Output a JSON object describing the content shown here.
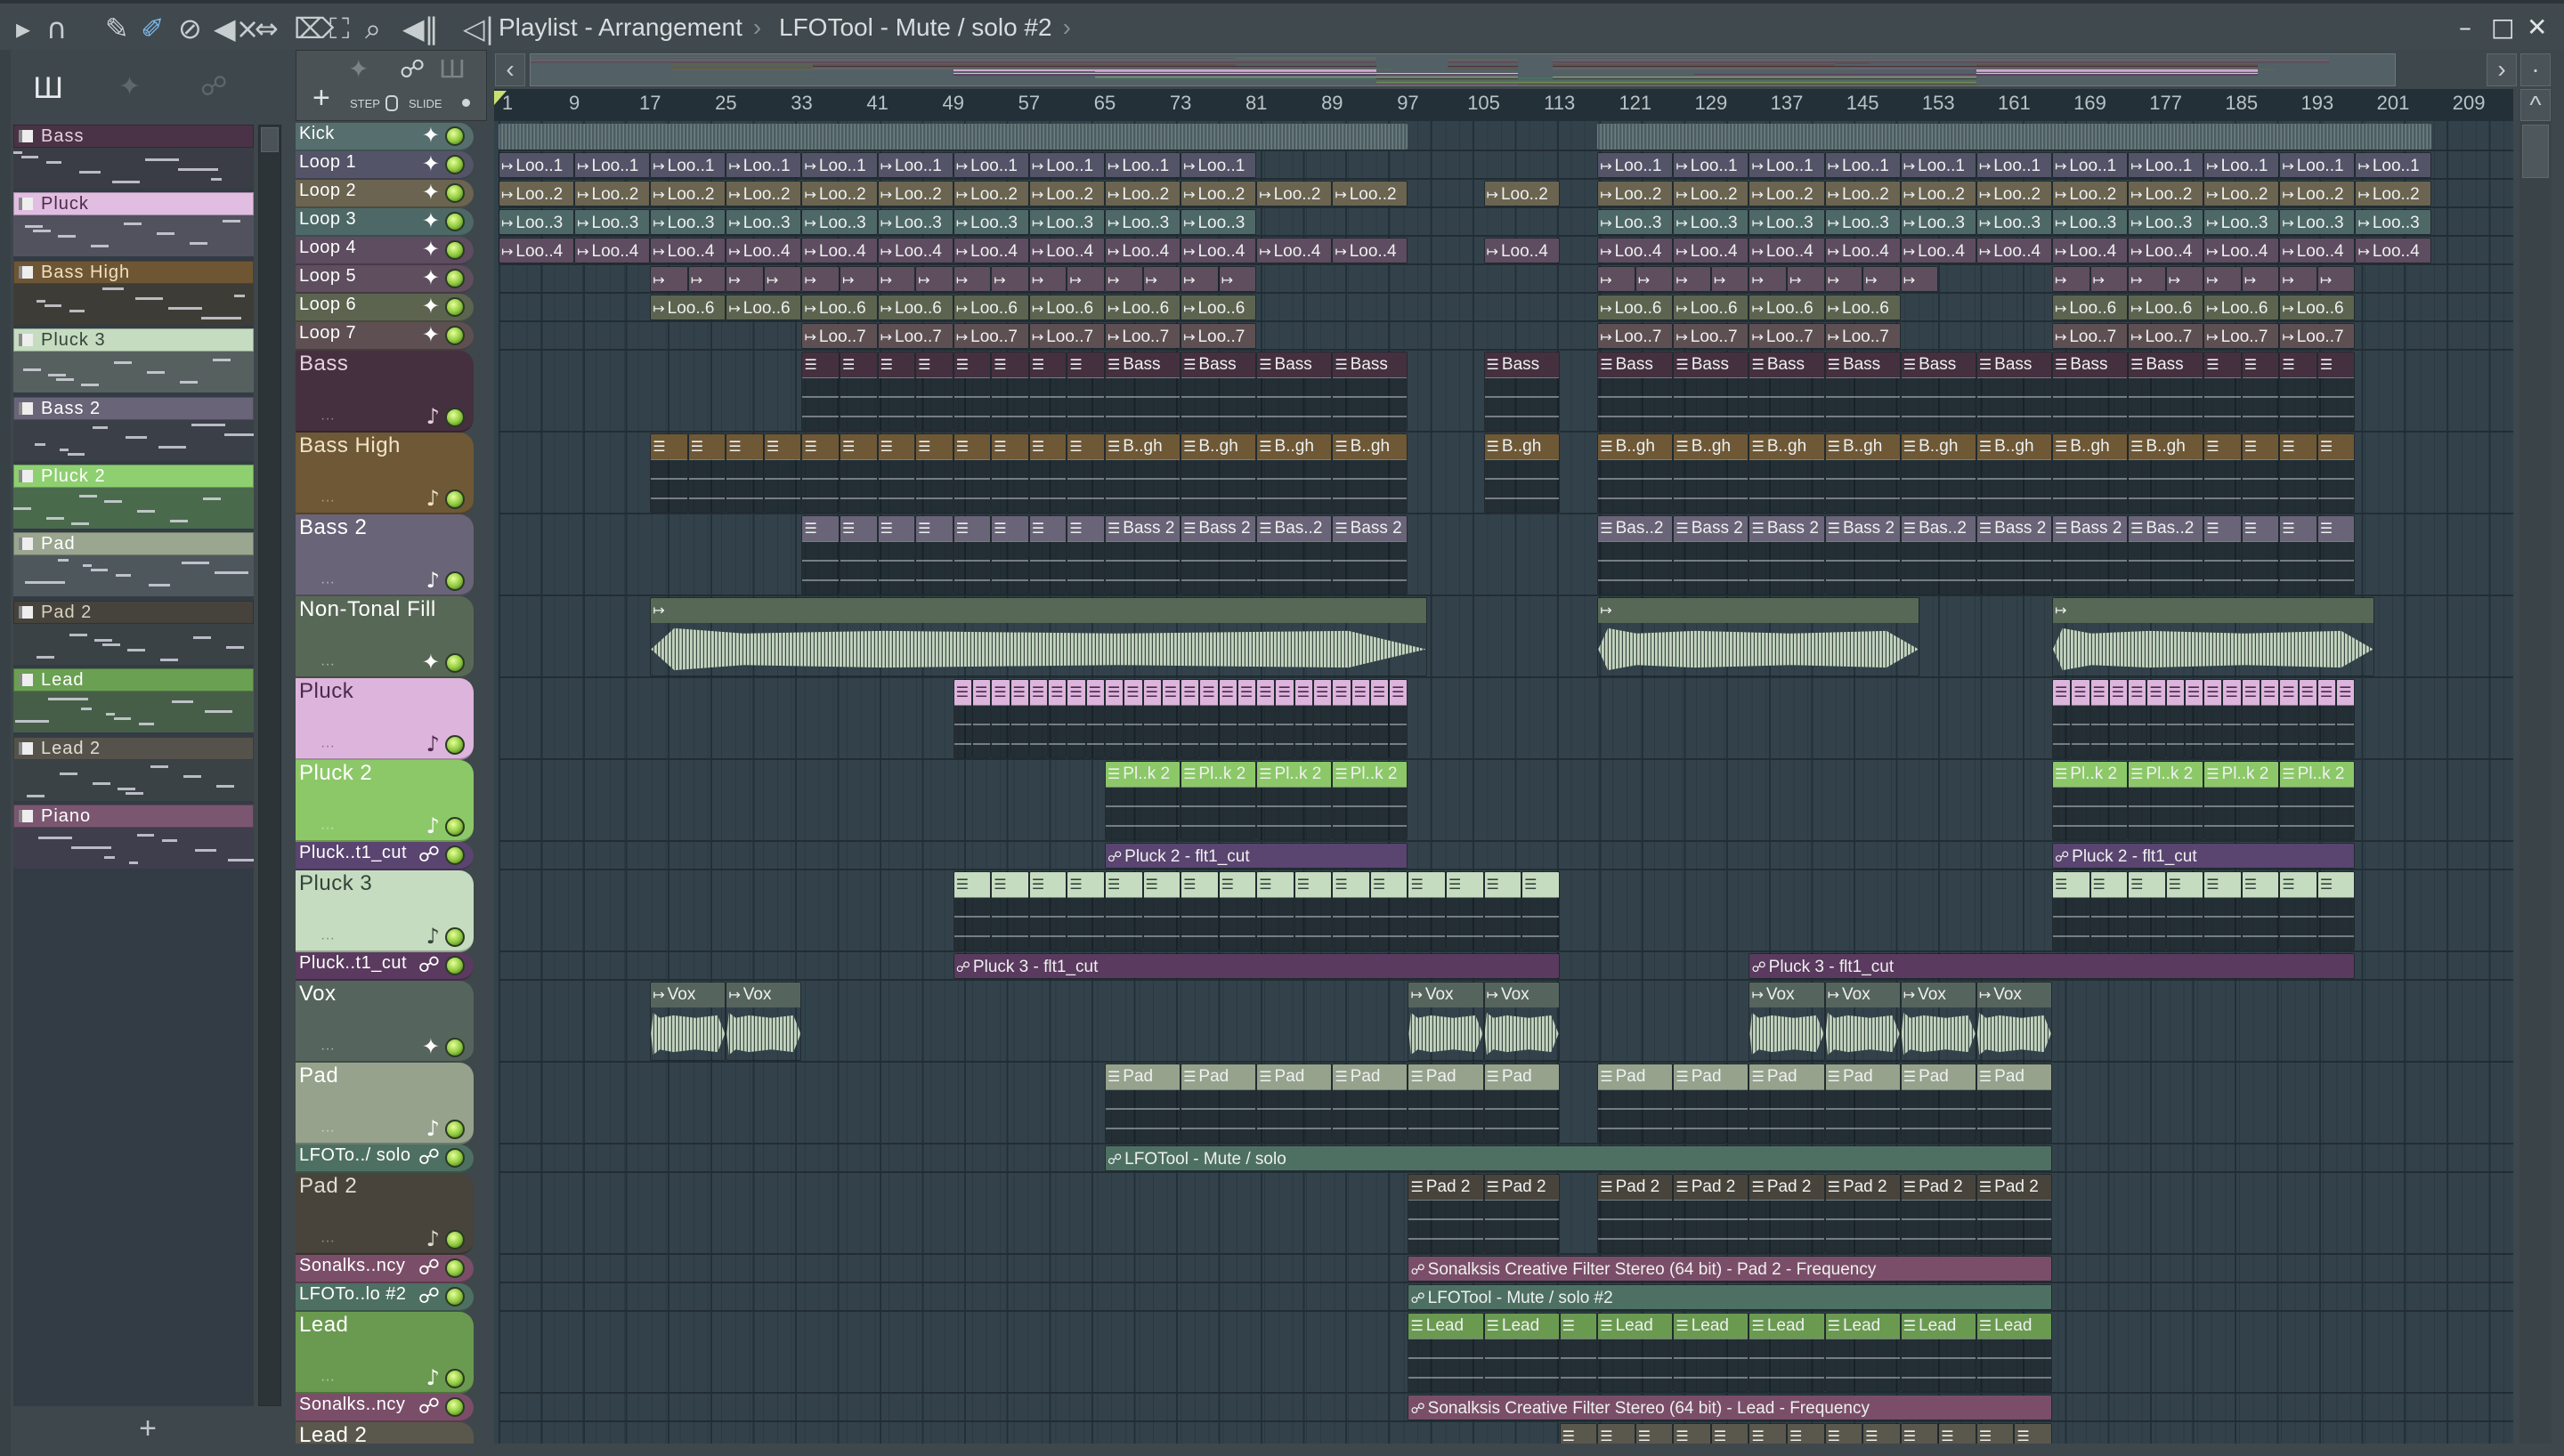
{
  "toolbar": {
    "icons": [
      "play-arrow",
      "magnet",
      "pencil",
      "paint-brush",
      "delete",
      "mute",
      "slip",
      "slice",
      "select",
      "zoom",
      "playback"
    ],
    "breadcrumb": [
      "Playlist - Arrangement",
      "LFOTool - Mute / solo #2"
    ],
    "breadcrumb_sep": "›"
  },
  "window": {
    "minimize": "–",
    "maximize": "□",
    "close": "✕"
  },
  "playlist_tools": {
    "add": "+",
    "step": "STEP",
    "slide": "SLIDE"
  },
  "nav": {
    "left": "‹",
    "right": "›",
    "up": "^",
    "dot": "·"
  },
  "picker_add": "+",
  "ruler": [
    "1",
    "9",
    "17",
    "25",
    "33",
    "41",
    "49",
    "57",
    "65",
    "73",
    "81",
    "89",
    "97",
    "105",
    "113",
    "121",
    "129",
    "137",
    "145",
    "153",
    "161",
    "169",
    "177",
    "185",
    "193",
    "201",
    "209"
  ],
  "picker": [
    {
      "name": "Bass",
      "color": "#4a3346",
      "text": "#e6d0e0",
      "body": "#3a3c46"
    },
    {
      "name": "Pluck",
      "color": "#e2bde2",
      "text": "#4a2c4a",
      "body": "#52525e"
    },
    {
      "name": "Bass High",
      "color": "#6e5634",
      "text": "#f0e0c0",
      "body": "#3e3c36"
    },
    {
      "name": "Pluck 3",
      "color": "#c6dcc0",
      "text": "#34443a",
      "body": "#56605e"
    },
    {
      "name": "Bass 2",
      "color": "#6a6478",
      "text": "#ffffff",
      "body": "#3a3f48"
    },
    {
      "name": "Pluck 2",
      "color": "#8ed070",
      "text": "#ffffff",
      "body": "#4a6a4c"
    },
    {
      "name": "Pad",
      "color": "#9aa690",
      "text": "#ffffff",
      "body": "#4e585c"
    },
    {
      "name": "Pad 2",
      "color": "#46433c",
      "text": "#d8d0c0",
      "body": "#3a4246"
    },
    {
      "name": "Lead",
      "color": "#6aa052",
      "text": "#ffffff",
      "body": "#465e48"
    },
    {
      "name": "Lead 2",
      "color": "#54524a",
      "text": "#e0ddd0",
      "body": "#3a4246"
    },
    {
      "name": "Piano",
      "color": "#7a5670",
      "text": "#ffffff",
      "body": "#3e3e4c"
    }
  ],
  "tracks": [
    {
      "name": "Kick",
      "color": "#566e6e",
      "text": "#ffffff",
      "size": "s",
      "icon": "wave",
      "kind": "kick",
      "clips": [
        [
          1,
          1,
          96,
          ""
        ],
        [
          117,
          1,
          88,
          ""
        ]
      ]
    },
    {
      "name": "Loop 1",
      "color": "#545468",
      "text": "#ffffff",
      "size": "s",
      "icon": "wave",
      "kind": "audio",
      "clips": [
        [
          1,
          10,
          8,
          "Loo..1"
        ],
        [
          117,
          11,
          8,
          "Loo..1"
        ]
      ]
    },
    {
      "name": "Loop 2",
      "color": "#6a6450",
      "text": "#ffffff",
      "size": "s",
      "icon": "wave",
      "kind": "audio",
      "clips": [
        [
          1,
          12,
          8,
          "Loo..2"
        ],
        [
          105,
          1,
          8,
          "Loo..2"
        ],
        [
          117,
          11,
          8,
          "Loo..2"
        ]
      ]
    },
    {
      "name": "Loop 3",
      "color": "#4e6868",
      "text": "#ffffff",
      "size": "s",
      "icon": "wave",
      "kind": "audio",
      "clips": [
        [
          1,
          10,
          8,
          "Loo..3"
        ],
        [
          117,
          11,
          8,
          "Loo..3"
        ]
      ]
    },
    {
      "name": "Loop 4",
      "color": "#5e4c60",
      "text": "#ffffff",
      "size": "s",
      "icon": "wave",
      "kind": "audio",
      "clips": [
        [
          1,
          12,
          8,
          "Loo..4"
        ],
        [
          105,
          1,
          8,
          "Loo..4"
        ],
        [
          117,
          11,
          8,
          "Loo..4"
        ]
      ]
    },
    {
      "name": "Loop 5",
      "color": "#5e4e5e",
      "text": "#ffffff",
      "size": "s",
      "icon": "wave",
      "kind": "audio",
      "clips": [
        [
          17,
          16,
          4,
          ""
        ],
        [
          117,
          9,
          4,
          ""
        ],
        [
          165,
          8,
          4,
          ""
        ]
      ]
    },
    {
      "name": "Loop 6",
      "color": "#5c6450",
      "text": "#ffffff",
      "size": "s",
      "icon": "wave",
      "kind": "audio",
      "clips": [
        [
          17,
          8,
          8,
          "Loo..6"
        ],
        [
          117,
          4,
          8,
          "Loo..6"
        ],
        [
          165,
          4,
          8,
          "Loo..6"
        ]
      ]
    },
    {
      "name": "Loop 7",
      "color": "#5e5052",
      "text": "#ffffff",
      "size": "s",
      "icon": "wave",
      "kind": "audio",
      "clips": [
        [
          33,
          6,
          8,
          "Loo..7"
        ],
        [
          117,
          4,
          8,
          "Loo..7"
        ],
        [
          165,
          4,
          8,
          "Loo..7"
        ]
      ]
    },
    {
      "name": "Bass",
      "color": "#45303f",
      "text": "#e8d0e0",
      "size": "l",
      "icon": "note",
      "kind": "pattern",
      "clips": [
        [
          33,
          8,
          4,
          ""
        ],
        [
          65,
          4,
          8,
          "Bass"
        ],
        [
          105,
          1,
          8,
          "Bass"
        ],
        [
          117,
          8,
          8,
          "Bass"
        ],
        [
          181,
          4,
          4,
          ""
        ]
      ]
    },
    {
      "name": "Bass High",
      "color": "#6e5836",
      "text": "#f0e4c8",
      "size": "l",
      "icon": "note",
      "kind": "pattern",
      "clips": [
        [
          17,
          12,
          4,
          ""
        ],
        [
          65,
          4,
          8,
          "B..gh"
        ],
        [
          105,
          1,
          8,
          "B..gh"
        ],
        [
          117,
          8,
          8,
          "B..gh"
        ],
        [
          181,
          4,
          4,
          ""
        ]
      ]
    },
    {
      "name": "Bass 2",
      "color": "#6a6478",
      "text": "#ffffff",
      "size": "l",
      "icon": "note",
      "kind": "pattern",
      "clips": [
        [
          33,
          8,
          4,
          ""
        ],
        [
          65,
          2,
          8,
          "Bass 2"
        ],
        [
          81,
          1,
          8,
          "Bas..2"
        ],
        [
          89,
          1,
          8,
          "Bass 2"
        ],
        [
          117,
          1,
          8,
          "Bas..2"
        ],
        [
          125,
          3,
          8,
          "Bass 2"
        ],
        [
          149,
          1,
          8,
          "Bas..2"
        ],
        [
          157,
          2,
          8,
          "Bass 2"
        ],
        [
          173,
          1,
          8,
          "Bas..2"
        ],
        [
          181,
          4,
          4,
          ""
        ]
      ]
    },
    {
      "name": "Non-Tonal Fill",
      "color": "#586856",
      "text": "#ffffff",
      "size": "l",
      "icon": "wave",
      "kind": "bigaudio",
      "clips": [
        [
          17,
          1,
          82,
          ""
        ],
        [
          117,
          1,
          34,
          ""
        ],
        [
          165,
          1,
          34,
          ""
        ]
      ]
    },
    {
      "name": "Pluck",
      "color": "#dcb4dc",
      "text": "#4a2a4a",
      "size": "l",
      "icon": "note",
      "kind": "pattern",
      "clips": [
        [
          49,
          24,
          2,
          ""
        ],
        [
          165,
          16,
          2,
          ""
        ]
      ]
    },
    {
      "name": "Pluck 2",
      "color": "#8cc868",
      "text": "#ffffff",
      "size": "l",
      "icon": "note",
      "kind": "pattern",
      "clips": [
        [
          65,
          4,
          8,
          "Pl..k 2"
        ],
        [
          165,
          4,
          8,
          "Pl..k 2"
        ]
      ]
    },
    {
      "name": "Pluck..t1_cut",
      "color": "#5a4470",
      "text": "#ffffff",
      "size": "s",
      "icon": "auto",
      "kind": "auto",
      "clips": [
        [
          65,
          1,
          32,
          "Pluck 2 - flt1_cut"
        ],
        [
          165,
          1,
          32,
          "Pluck 2 - flt1_cut"
        ]
      ]
    },
    {
      "name": "Pluck 3",
      "color": "#c6dcc0",
      "text": "#34443a",
      "size": "l",
      "icon": "note",
      "kind": "pattern",
      "clips": [
        [
          49,
          16,
          4,
          ""
        ],
        [
          165,
          8,
          4,
          ""
        ]
      ]
    },
    {
      "name": "Pluck..t1_cut",
      "color": "#5a3a5e",
      "text": "#ffffff",
      "size": "s",
      "icon": "auto",
      "kind": "auto",
      "clips": [
        [
          49,
          1,
          64,
          "Pluck 3 - flt1_cut"
        ],
        [
          133,
          1,
          64,
          "Pluck 3 - flt1_cut"
        ]
      ]
    },
    {
      "name": "Vox",
      "color": "#56645e",
      "text": "#ffffff",
      "size": "l",
      "icon": "wave",
      "kind": "bigaudio",
      "clips": [
        [
          17,
          2,
          8,
          "Vox"
        ],
        [
          97,
          2,
          8,
          "Vox"
        ],
        [
          133,
          4,
          8,
          "Vox"
        ]
      ]
    },
    {
      "name": "Pad",
      "color": "#96a28c",
      "text": "#ffffff",
      "size": "l",
      "icon": "note",
      "kind": "pattern",
      "clips": [
        [
          65,
          6,
          8,
          "Pad"
        ],
        [
          117,
          6,
          8,
          "Pad"
        ]
      ]
    },
    {
      "name": "LFOTo../ solo",
      "color": "#4e7062",
      "text": "#ffffff",
      "size": "s",
      "icon": "auto",
      "kind": "auto",
      "clips": [
        [
          65,
          1,
          100,
          "LFOTool - Mute / solo"
        ]
      ]
    },
    {
      "name": "Pad 2",
      "color": "#48443c",
      "text": "#e0dcd0",
      "size": "l",
      "icon": "note",
      "kind": "pattern",
      "clips": [
        [
          97,
          2,
          8,
          "Pad 2"
        ],
        [
          117,
          6,
          8,
          "Pad 2"
        ]
      ]
    },
    {
      "name": "Sonalks..ncy",
      "color": "#7a4e68",
      "text": "#ffffff",
      "size": "s",
      "icon": "auto",
      "kind": "auto",
      "clips": [
        [
          97,
          1,
          68,
          "Sonalksis Creative Filter Stereo (64 bit) - Pad 2 - Frequency"
        ]
      ]
    },
    {
      "name": "LFOTo..lo #2",
      "color": "#4e7062",
      "text": "#ffffff",
      "size": "s",
      "icon": "auto",
      "kind": "auto",
      "clips": [
        [
          97,
          1,
          68,
          "LFOTool - Mute / solo #2"
        ]
      ]
    },
    {
      "name": "Lead",
      "color": "#6a9a50",
      "text": "#ffffff",
      "size": "l",
      "icon": "note",
      "kind": "pattern",
      "clips": [
        [
          97,
          2,
          8,
          "Lead"
        ],
        [
          113,
          1,
          4,
          ""
        ],
        [
          117,
          6,
          8,
          "Lead"
        ]
      ]
    },
    {
      "name": "Sonalks..ncy",
      "color": "#7a4e68",
      "text": "#ffffff",
      "size": "s",
      "icon": "auto",
      "kind": "auto",
      "clips": [
        [
          97,
          1,
          68,
          "Sonalksis Creative Filter Stereo (64 bit) - Lead - Frequency"
        ]
      ]
    },
    {
      "name": "Lead 2",
      "color": "#5a584c",
      "text": "#ffffff",
      "size": "l",
      "icon": "note",
      "kind": "pattern",
      "clips": [
        [
          113,
          13,
          4,
          ""
        ]
      ]
    }
  ]
}
